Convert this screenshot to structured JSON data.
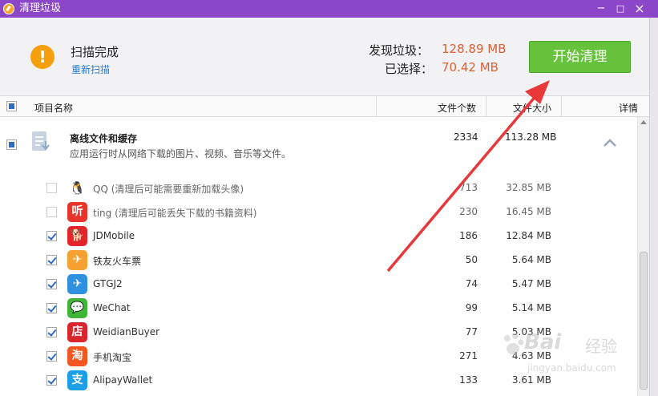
{
  "window": {
    "title": "清理垃圾",
    "min": "−",
    "max": "□",
    "close": "×"
  },
  "header": {
    "status": "扫描完成",
    "rescan": "重新扫描",
    "found_label": "发现垃圾：",
    "found_value": "128.89 MB",
    "selected_label": "已选择：",
    "selected_value": "70.42 MB",
    "clean_button": "开始清理"
  },
  "columns": {
    "name": "项目名称",
    "count": "文件个数",
    "size": "文件大小",
    "detail": "详情"
  },
  "group": {
    "title": "离线文件和缓存",
    "desc": "应用运行时从网络下载的图片、视频、音乐等文件。",
    "count": "2334",
    "size": "113.28 MB"
  },
  "items": [
    {
      "name": "QQ (清理后可能需要重新加载头像)",
      "count": "713",
      "size": "32.85 MB",
      "checked": false,
      "icon": "qq-icon",
      "glyph": "🐧",
      "color": "#ffffff"
    },
    {
      "name": "ting (清理后可能丢失下载的书籍资料)",
      "count": "230",
      "size": "16.45 MB",
      "checked": false,
      "icon": "ting-icon",
      "glyph": "听",
      "color": "#e8352b"
    },
    {
      "name": "JDMobile",
      "count": "186",
      "size": "12.84 MB",
      "checked": true,
      "icon": "jd-icon",
      "glyph": "🐕",
      "color": "#e3242b"
    },
    {
      "name": "铁友火车票",
      "count": "50",
      "size": "5.64 MB",
      "checked": true,
      "icon": "train-ticket-icon",
      "glyph": "✈",
      "color": "#f7a133"
    },
    {
      "name": "GTGJ2",
      "count": "74",
      "size": "5.47 MB",
      "checked": true,
      "icon": "gtgj-icon",
      "glyph": "✈",
      "color": "#2f8fe0"
    },
    {
      "name": "WeChat",
      "count": "99",
      "size": "5.14 MB",
      "checked": true,
      "icon": "wechat-icon",
      "glyph": "💬",
      "color": "#3fb638"
    },
    {
      "name": "WeidianBuyer",
      "count": "77",
      "size": "5.03 MB",
      "checked": true,
      "icon": "weidian-icon",
      "glyph": "店",
      "color": "#d9252b"
    },
    {
      "name": "手机淘宝",
      "count": "271",
      "size": "4.63 MB",
      "checked": true,
      "icon": "taobao-icon",
      "glyph": "淘",
      "color": "#f4561f"
    },
    {
      "name": "AlipayWallet",
      "count": "133",
      "size": "3.61 MB",
      "checked": true,
      "icon": "alipay-icon",
      "glyph": "支",
      "color": "#1a9fe8"
    }
  ],
  "watermark": {
    "brand": "Bai",
    "brand2": "经验",
    "url": "jingyan.baidu.com"
  }
}
